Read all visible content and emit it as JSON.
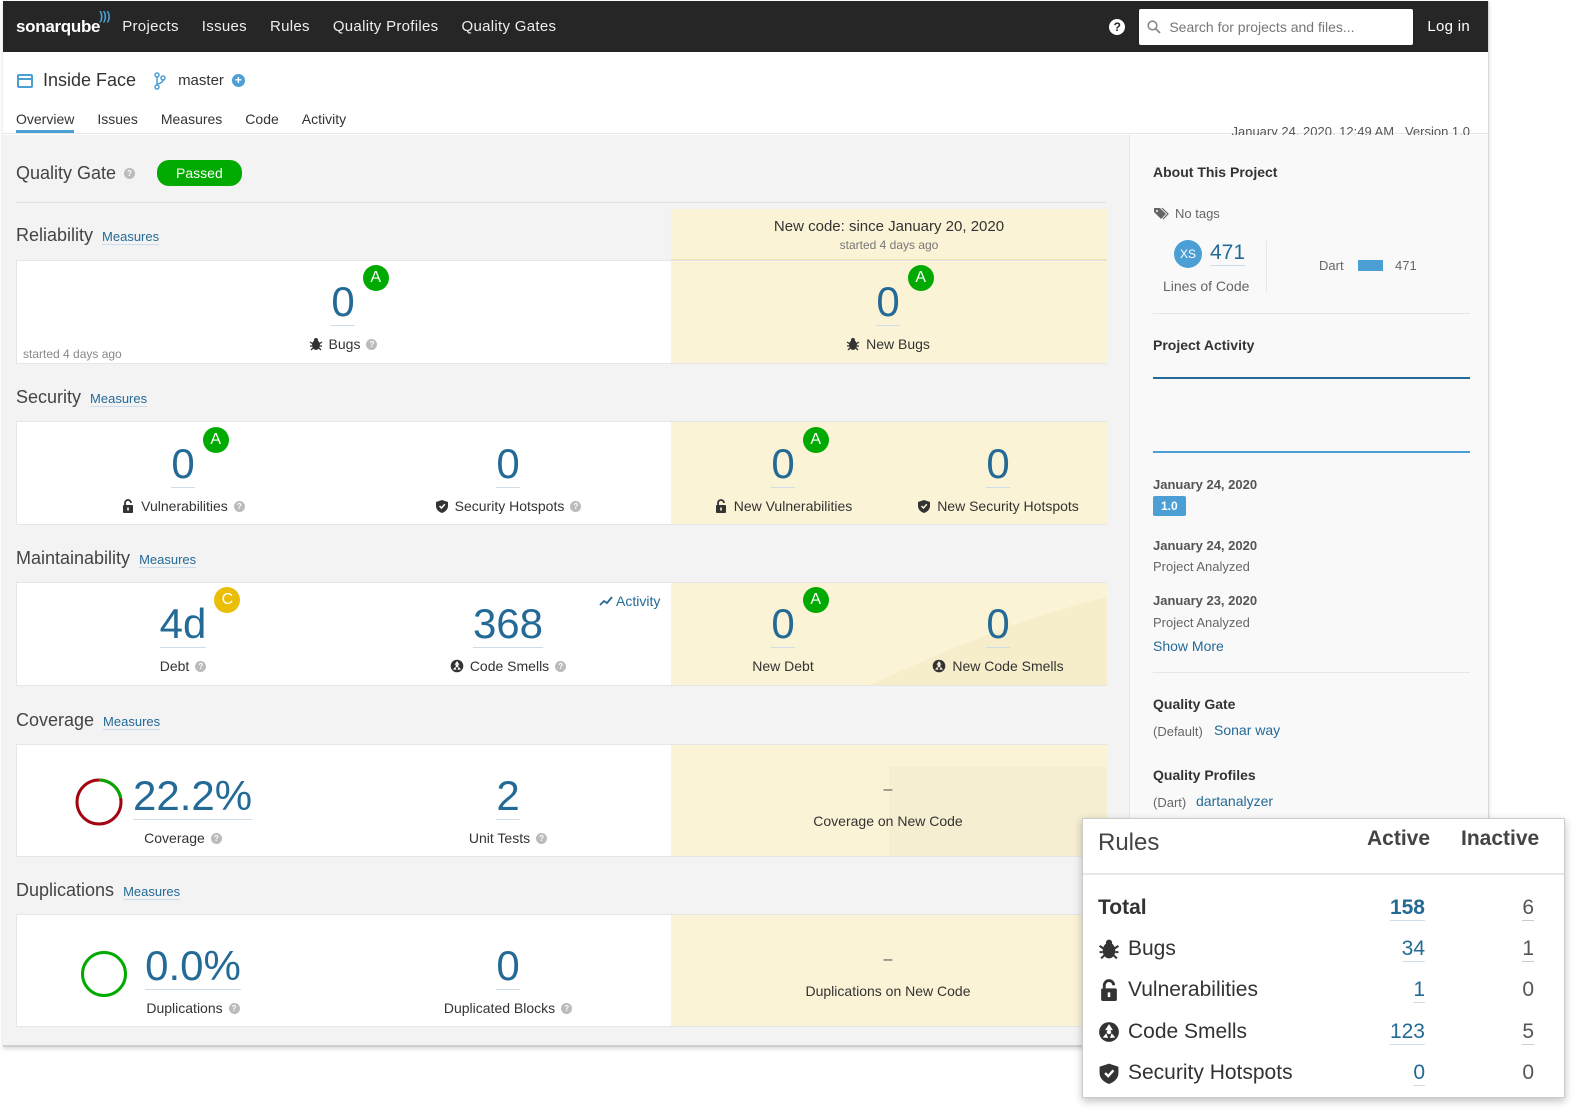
{
  "nav": {
    "logo": "sonarqube",
    "links": [
      "Projects",
      "Issues",
      "Rules",
      "Quality Profiles",
      "Quality Gates"
    ],
    "search_placeholder": "Search for projects and files...",
    "login": "Log in"
  },
  "project": {
    "name": "Inside Face",
    "branch": "master",
    "date": "January 24, 2020, 12:49 AM",
    "version": "Version 1.0",
    "tabs": [
      "Overview",
      "Issues",
      "Measures",
      "Code",
      "Activity"
    ]
  },
  "quality_gate": {
    "label": "Quality Gate",
    "status": "Passed"
  },
  "new_code": {
    "title": "New code: since January 20, 2020",
    "subtitle": "started 4 days ago"
  },
  "reliability": {
    "title": "Reliability",
    "measures": "Measures",
    "bugs": {
      "value": "0",
      "rating": "A",
      "label": "Bugs"
    },
    "new_bugs": {
      "value": "0",
      "rating": "A",
      "label": "New Bugs"
    },
    "note": "started 4 days ago"
  },
  "security": {
    "title": "Security",
    "measures": "Measures",
    "vulnerabilities": {
      "value": "0",
      "rating": "A",
      "label": "Vulnerabilities"
    },
    "hotspots": {
      "value": "0",
      "label": "Security Hotspots"
    },
    "new_vulnerabilities": {
      "value": "0",
      "rating": "A",
      "label": "New Vulnerabilities"
    },
    "new_hotspots": {
      "value": "0",
      "label": "New Security Hotspots"
    }
  },
  "maintainability": {
    "title": "Maintainability",
    "measures": "Measures",
    "debt": {
      "value": "4d",
      "rating": "C",
      "label": "Debt"
    },
    "smells": {
      "value": "368",
      "label": "Code Smells"
    },
    "activity": "Activity",
    "new_debt": {
      "value": "0",
      "rating": "A",
      "label": "New Debt"
    },
    "new_smells": {
      "value": "0",
      "label": "New Code Smells"
    }
  },
  "coverage": {
    "title": "Coverage",
    "measures": "Measures",
    "coverage": {
      "value": "22.2%",
      "label": "Coverage",
      "fraction": 0.222
    },
    "unit_tests": {
      "value": "2",
      "label": "Unit Tests"
    },
    "new_coverage": {
      "value": "–",
      "label": "Coverage on New Code"
    }
  },
  "duplications": {
    "title": "Duplications",
    "measures": "Measures",
    "duplications": {
      "value": "0.0%",
      "label": "Duplications"
    },
    "blocks": {
      "value": "0",
      "label": "Duplicated Blocks"
    },
    "new_duplications": {
      "value": "–",
      "label": "Duplications on New Code"
    }
  },
  "sidebar": {
    "about": "About This Project",
    "tags": "No tags",
    "size_badge": "XS",
    "loc_value": "471",
    "loc_label": "Lines of Code",
    "lang": "Dart",
    "lang_value": "471",
    "activity_title": "Project Activity",
    "events": [
      {
        "date": "January 24, 2020",
        "badge": "1.0"
      },
      {
        "date": "January 24, 2020",
        "desc": "Project Analyzed"
      },
      {
        "date": "January 23, 2020",
        "desc": "Project Analyzed"
      }
    ],
    "show_more": "Show More",
    "qg_title": "Quality Gate",
    "qg_default": "(Default)",
    "qg_link": "Sonar way",
    "qp_title": "Quality Profiles",
    "qp_lang": "(Dart)",
    "qp_link": "dartanalyzer"
  },
  "rules": {
    "title": "Rules",
    "col_active": "Active",
    "col_inactive": "Inactive",
    "rows": [
      {
        "name": "Total",
        "active": "158",
        "inactive": "6"
      },
      {
        "name": "Bugs",
        "active": "34",
        "inactive": "1"
      },
      {
        "name": "Vulnerabilities",
        "active": "1",
        "inactive": "0"
      },
      {
        "name": "Code Smells",
        "active": "123",
        "inactive": "5"
      },
      {
        "name": "Security Hotspots",
        "active": "0",
        "inactive": "0"
      }
    ]
  },
  "colors": {
    "accent": "#4b9fd5",
    "link": "#236a97",
    "passed": "#00aa00",
    "rating_a": "#00aa00",
    "rating_c": "#eabe06",
    "new_code_bg": "#fbf3d5",
    "nav_bg": "#262626"
  }
}
